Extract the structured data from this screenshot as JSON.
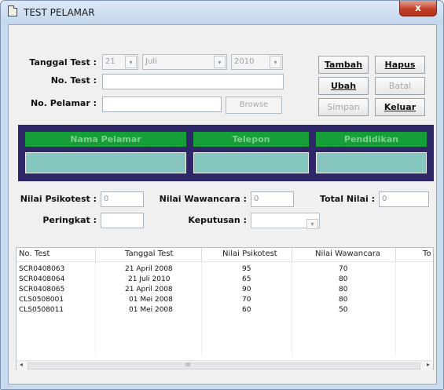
{
  "window": {
    "title": "TEST PELAMAR",
    "close_label": "x"
  },
  "form": {
    "tanggal_test_label": "Tanggal Test :",
    "day_value": "21",
    "month_value": "Juli",
    "year_value": "2010",
    "no_test_label": "No. Test :",
    "no_test_value": "",
    "no_pelamar_label": "No. Pelamar :",
    "no_pelamar_value": "",
    "browse_label": "Browse"
  },
  "buttons": {
    "tambah": "Tambah",
    "hapus": "Hapus",
    "ubah": "Ubah",
    "batal": "Batal",
    "simpan": "Simpan",
    "keluar": "Keluar"
  },
  "info_panel": {
    "headers": [
      "Nama Pelamar",
      "Telepon",
      "Pendidikan"
    ]
  },
  "scores": {
    "psikotest_label": "Nilai Psikotest :",
    "psikotest_value": "0",
    "wawancara_label": "Nilai Wawancara :",
    "wawancara_value": "0",
    "total_label": "Total Nilai :",
    "total_value": "0",
    "peringkat_label": "Peringkat :",
    "peringkat_value": "",
    "keputusan_label": "Keputusan :",
    "keputusan_value": ""
  },
  "grid": {
    "columns": [
      "No. Test",
      "Tanggal Test",
      "Nilai Psikotest",
      "Nilai Wawancara",
      "To"
    ],
    "rows": [
      [
        "SCR0408063",
        "21 April 2008",
        "95",
        "70"
      ],
      [
        "SCR0408064",
        "21 Juli 2010",
        "65",
        "80"
      ],
      [
        "SCR0408065",
        "21 April 2008",
        "90",
        "80"
      ],
      [
        "CLS0508001",
        "01 Mei 2008",
        "70",
        "80"
      ],
      [
        "CLS0508011",
        "01 Mei 2008",
        "60",
        "50"
      ]
    ]
  },
  "scrollbar": {
    "thumb_glyph": "III"
  },
  "icons": {
    "left_arrow": "◂",
    "right_arrow": "▸",
    "dropdown_arrow": "▾"
  }
}
